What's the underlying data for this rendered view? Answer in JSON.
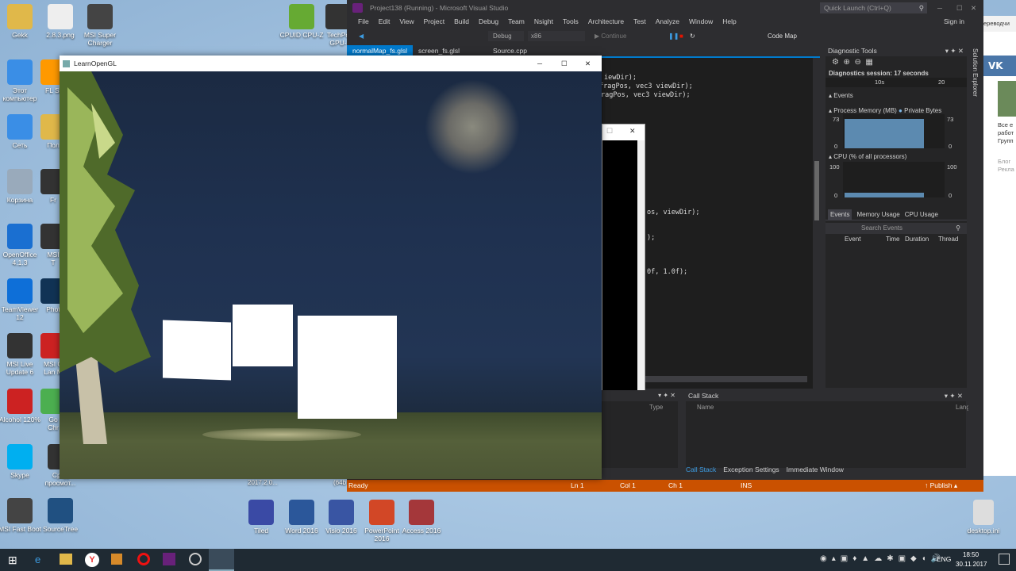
{
  "desktop": {
    "icons_left": [
      {
        "label": "Gekk",
        "icon": "folder-icon",
        "color": "#e0b84a"
      },
      {
        "label": "Этот\nкомпьютер",
        "icon": "computer-icon",
        "color": "#3a8ee6"
      },
      {
        "label": "Сеть",
        "icon": "network-icon",
        "color": "#3a8ee6"
      },
      {
        "label": "Корзина",
        "icon": "recycle-bin-icon",
        "color": "#9ab"
      },
      {
        "label": "OpenOffice\n4.1.3",
        "icon": "openoffice-icon",
        "color": "#1a6fd1"
      },
      {
        "label": "TeamViewer\n12",
        "icon": "teamviewer-icon",
        "color": "#0e6fd8"
      },
      {
        "label": "MSI Live\nUpdate 6",
        "icon": "msi-live-icon",
        "color": "#333"
      },
      {
        "label": "Alcohol 120%",
        "icon": "alcohol-icon",
        "color": "#c22"
      },
      {
        "label": "Skype",
        "icon": "skype-icon",
        "color": "#00aff0"
      },
      {
        "label": "MSI Fast Boot",
        "icon": "msi-fastboot-icon",
        "color": "#444"
      },
      {
        "label": "SourceTree",
        "icon": "sourcetree-icon",
        "color": "#205081"
      }
    ],
    "icons_col2": [
      {
        "label": "FL St",
        "icon": "flstudio-icon",
        "color": "#f90"
      },
      {
        "label": "Пол",
        "icon": "folder-icon",
        "color": "#e0b84a"
      },
      {
        "label": "Fr",
        "icon": "app-icon",
        "color": "#333"
      },
      {
        "label": "MSI\nT",
        "icon": "msi-icon",
        "color": "#333"
      },
      {
        "label": "Phot",
        "icon": "photo-icon",
        "color": "#135"
      },
      {
        "label": "MSI G\nLan M",
        "icon": "msi-icon",
        "color": "#c22"
      },
      {
        "label": "Go\nChr",
        "icon": "chrome-icon",
        "color": "#4caf50"
      },
      {
        "label": "Сред\nпросмот...",
        "icon": "viewer-icon",
        "color": "#333"
      }
    ],
    "icons_top": [
      {
        "label": "2.8.3.png",
        "icon": "image-file-icon",
        "color": "#eee"
      },
      {
        "label": "MSI Super\nCharger",
        "icon": "msi-charger-icon",
        "color": "#444"
      },
      {
        "label": "CPUID CPU-Z",
        "icon": "cpuz-icon",
        "color": "#6a3"
      },
      {
        "label": "TechPo\nGPU-",
        "icon": "gpuz-icon",
        "color": "#333"
      }
    ],
    "icons_bottom": [
      {
        "label": "Tiled",
        "icon": "tiled-icon",
        "color": "#3a4aa5"
      },
      {
        "label": "Word 2016",
        "icon": "word-icon",
        "color": "#2b579a"
      },
      {
        "label": "Visio 2016",
        "icon": "visio-icon",
        "color": "#3955a3"
      },
      {
        "label": "PowerPoint\n2016",
        "icon": "powerpoint-icon",
        "color": "#d24726"
      },
      {
        "label": "Access 2016",
        "icon": "access-icon",
        "color": "#a4373a"
      }
    ],
    "file_right": {
      "label": "desktop.ini",
      "icon": "ini-file-icon"
    },
    "behind_labels": [
      "2017.2.0...",
      "(64b"
    ]
  },
  "vs": {
    "title": "Project138 (Running) - Microsoft Visual Studio",
    "quick_launch": "Quick Launch (Ctrl+Q)",
    "sign_in": "Sign in",
    "menu": [
      "File",
      "Edit",
      "View",
      "Project",
      "Build",
      "Debug",
      "Team",
      "Nsight",
      "Tools",
      "Architecture",
      "Test",
      "Analyze",
      "Window",
      "Help"
    ],
    "toolbar": {
      "config": "Debug",
      "platform": "x86",
      "continue": "Continue",
      "codemap": "Code Map"
    },
    "tabs": [
      "normalMap_fs.glsl",
      "screen_fs.glsl",
      "Source.cpp"
    ],
    "code_lines": [
      "iewDir);",
      "  fragPos, vec3 viewDir);",
      "ragPos, vec3 viewDir);",
      "os, viewDir);",
      ");",
      "0f, 1.0f);"
    ],
    "status": {
      "ready": "Ready",
      "ln": "Ln 1",
      "col": "Col 1",
      "ch": "Ch 1",
      "ins": "INS",
      "publish": "Publish"
    },
    "bottom_panel": {
      "type_col": "Type",
      "callstack_title": "Call Stack",
      "name_col": "Name",
      "lang_col": "Lang",
      "tabs": [
        "Call Stack",
        "Exception Settings",
        "Immediate Window"
      ]
    },
    "diag": {
      "title": "Diagnostic Tools",
      "session": "Diagnostics session: 17 seconds",
      "ruler": [
        "10s",
        "20"
      ],
      "events": "Events",
      "memory": "Process Memory (MB)",
      "private": "Private Bytes",
      "mem_max": "73",
      "mem_min": "0",
      "cpu": "CPU (% of all processors)",
      "cpu_max": "100",
      "cpu_min": "0",
      "tabs": [
        "Events",
        "Memory Usage",
        "CPU Usage"
      ],
      "search": "Search Events",
      "cols": [
        "Event",
        "Time",
        "Duration",
        "Thread"
      ]
    },
    "solution_explorer": "Solution Explorer"
  },
  "gl_window": {
    "title": "LearnOpenGL"
  },
  "browser_side": {
    "top": "ереводчи",
    "line1": "Все е",
    "line2": "работ",
    "line3": "Групп",
    "blog": "Блог",
    "ads": "Рекла"
  },
  "taskbar": {
    "lang": "ENG",
    "time": "18:50",
    "date": "30.11.2017"
  }
}
